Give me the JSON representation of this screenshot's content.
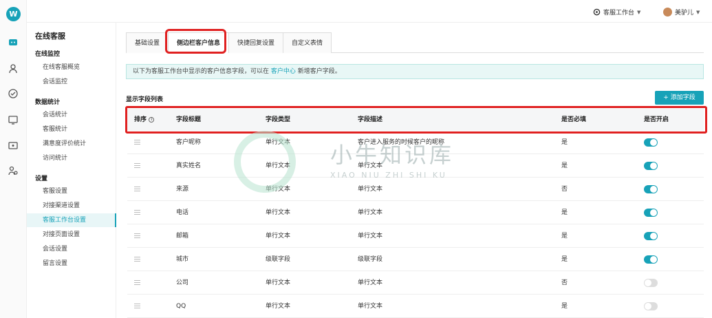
{
  "brand": {
    "accent": "#17a2b8",
    "highlight": "#e02020"
  },
  "rail": {
    "logo_text": "W",
    "icons": [
      "chat-icon",
      "monitor-person-icon",
      "check-circle-icon",
      "stats-screen-icon",
      "screen-icon",
      "users-icon"
    ]
  },
  "sidebar": {
    "title": "在线客服",
    "groups": [
      {
        "label": "在线监控",
        "items": [
          "在线客服概览",
          "会话监控"
        ]
      },
      {
        "label": "数据统计",
        "items": [
          "会话统计",
          "客服统计",
          "满意度评价统计",
          "访问统计"
        ]
      },
      {
        "label": "设置",
        "items": [
          "客服设置",
          "对接渠道设置",
          "客服工作台设置",
          "对接页面设置",
          "会话设置",
          "留言设置"
        ]
      }
    ],
    "active_item": "客服工作台设置"
  },
  "topbar": {
    "workspace_label": "客服工作台",
    "user_name": "美驴儿"
  },
  "tabs": [
    "基础设置",
    "侧边栏客户信息",
    "快捷回复设置",
    "自定义表情"
  ],
  "active_tab": "侧边栏客户信息",
  "notice": {
    "before": "以下为客服工作台中显示的客户信息字段，可以在",
    "link": "客户中心",
    "after": "新增客户字段。"
  },
  "list": {
    "title": "显示字段列表",
    "add_button": "+ 添加字段"
  },
  "table": {
    "headers": [
      "排序",
      "字段标题",
      "字段类型",
      "字段描述",
      "是否必填",
      "是否开启"
    ],
    "rows": [
      {
        "title": "客户昵称",
        "type": "单行文本",
        "desc": "客户进入服务的时候客户的昵称",
        "required": "是",
        "enabled": true
      },
      {
        "title": "真实姓名",
        "type": "单行文本",
        "desc": "单行文本",
        "required": "是",
        "enabled": true
      },
      {
        "title": "来源",
        "type": "单行文本",
        "desc": "单行文本",
        "required": "否",
        "enabled": true
      },
      {
        "title": "电话",
        "type": "单行文本",
        "desc": "单行文本",
        "required": "是",
        "enabled": true
      },
      {
        "title": "邮箱",
        "type": "单行文本",
        "desc": "单行文本",
        "required": "是",
        "enabled": true
      },
      {
        "title": "城市",
        "type": "级联字段",
        "desc": "级联字段",
        "required": "是",
        "enabled": true
      },
      {
        "title": "公司",
        "type": "单行文本",
        "desc": "单行文本",
        "required": "否",
        "enabled": false
      },
      {
        "title": "QQ",
        "type": "单行文本",
        "desc": "单行文本",
        "required": "是",
        "enabled": false
      }
    ]
  },
  "watermark": {
    "cn": "小牛知识库",
    "en": "XIAO NIU ZHI SHI KU"
  }
}
